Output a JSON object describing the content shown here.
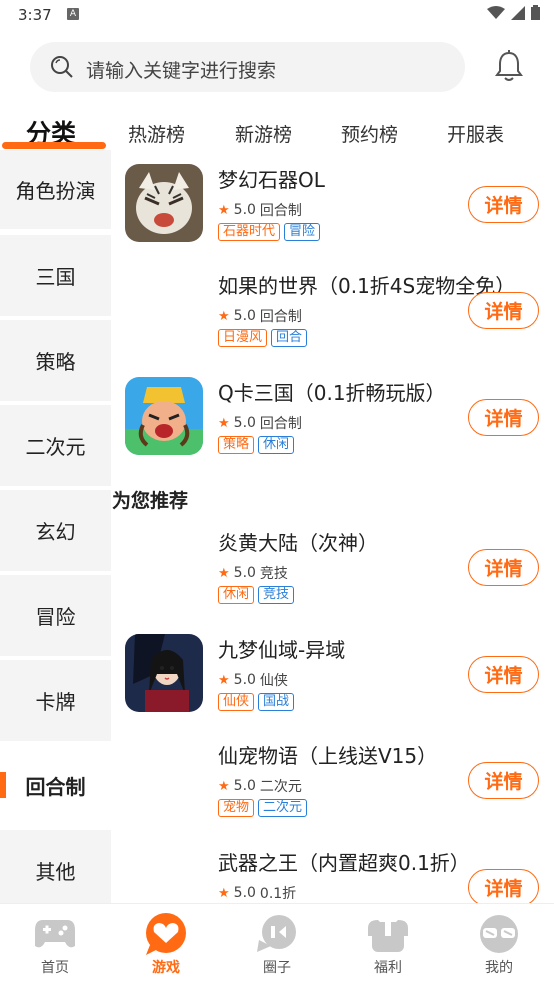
{
  "status_bar": {
    "time": "3:37",
    "notification_icon": "A"
  },
  "search": {
    "placeholder": "请输入关键字进行搜索"
  },
  "tabs": [
    {
      "label": "分类"
    },
    {
      "label": "热游榜"
    },
    {
      "label": "新游榜"
    },
    {
      "label": "预约榜"
    },
    {
      "label": "开服表"
    }
  ],
  "sidebar": {
    "items": [
      {
        "label": "角色扮演"
      },
      {
        "label": "三国"
      },
      {
        "label": "策略"
      },
      {
        "label": "二次元"
      },
      {
        "label": "玄幻"
      },
      {
        "label": "冒险"
      },
      {
        "label": "卡牌"
      },
      {
        "label": "回合制"
      },
      {
        "label": "其他"
      }
    ],
    "active": "回合制"
  },
  "recommend_title": "为您推荐",
  "games": [
    {
      "title": "梦幻石器OL",
      "rating": "5.0",
      "category": "回合制",
      "tags": [
        "石器时代",
        "冒险"
      ],
      "button": "详情"
    },
    {
      "title": "如果的世界（0.1折4S宠物全免）",
      "rating": "5.0",
      "category": "回合制",
      "tags": [
        "日漫风",
        "回合"
      ],
      "button": "详情"
    },
    {
      "title": "Q卡三国（0.1折畅玩版）",
      "rating": "5.0",
      "category": "回合制",
      "tags": [
        "策略",
        "休闲"
      ],
      "button": "详情"
    },
    {
      "title": "炎黄大陆（次神）",
      "rating": "5.0",
      "category": "竞技",
      "tags": [
        "休闲",
        "竞技"
      ],
      "button": "详情"
    },
    {
      "title": "九梦仙域-异域",
      "rating": "5.0",
      "category": "仙侠",
      "tags": [
        "仙侠",
        "国战"
      ],
      "button": "详情"
    },
    {
      "title": "仙宠物语（上线送V15）",
      "rating": "5.0",
      "category": "二次元",
      "tags": [
        "宠物",
        "二次元"
      ],
      "button": "详情"
    },
    {
      "title": "武器之王（内置超爽0.1折）",
      "rating": "5.0",
      "category": "0.1折",
      "tags": [],
      "button": "详情"
    }
  ],
  "bottom_nav": [
    {
      "label": "首页",
      "icon": "gamepad-icon"
    },
    {
      "label": "游戏",
      "icon": "heart-chat-icon",
      "active": true
    },
    {
      "label": "圈子",
      "icon": "chat-bubble-icon"
    },
    {
      "label": "福利",
      "icon": "gift-icon"
    },
    {
      "label": "我的",
      "icon": "sunglasses-icon"
    }
  ],
  "colors": {
    "accent": "#ff6a13",
    "tag_blue": "#2a7fd8",
    "sidebar_bg": "#f4f4f4"
  }
}
